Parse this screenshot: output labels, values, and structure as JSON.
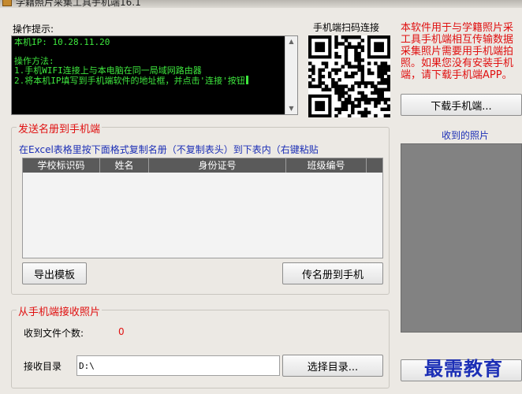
{
  "window": {
    "title": "学籍照片采集工具手机端16.1"
  },
  "tips": {
    "label": "操作提示:",
    "console": {
      "ip_line": "本机IP: 10.28.11.20",
      "method_title": "操作方法:",
      "step1": "1.手机WIFI连接上与本电脑在同一局域网路由器",
      "step2": "2.将本机IP填写到手机端软件的地址框，并点击'连接'按钮"
    }
  },
  "qr": {
    "label": "手机端扫码连接"
  },
  "info": {
    "lines": [
      "本软件用于与学籍照片采",
      "工具手机端相互传输数据",
      "采集照片需要用手机端拍",
      "照。如果您没有安装手机",
      "端，请下载手机端APP。"
    ]
  },
  "download_button": "下载手机端...",
  "send_group": {
    "title": "发送名册到手机端",
    "instruction": "在Excel表格里按下面格式复制名册（不复制表头）到下表内（右键粘贴",
    "columns": [
      "学校标识码",
      "姓名",
      "身份证号",
      "班级编号"
    ],
    "export_button": "导出模板",
    "send_button": "传名册到手机"
  },
  "receive_group": {
    "title": "从手机端接收照片",
    "count_label": "收到文件个数:",
    "count_value": "0",
    "dir_label": "接收目录",
    "dir_value": "D:\\",
    "choose_button": "选择目录..."
  },
  "photos": {
    "label": "收到的照片"
  },
  "watermark": "最需教育",
  "colors": {
    "accent_red": "#e01010",
    "console_green": "#3ee83e",
    "instruction_blue": "#1c2fb6"
  }
}
